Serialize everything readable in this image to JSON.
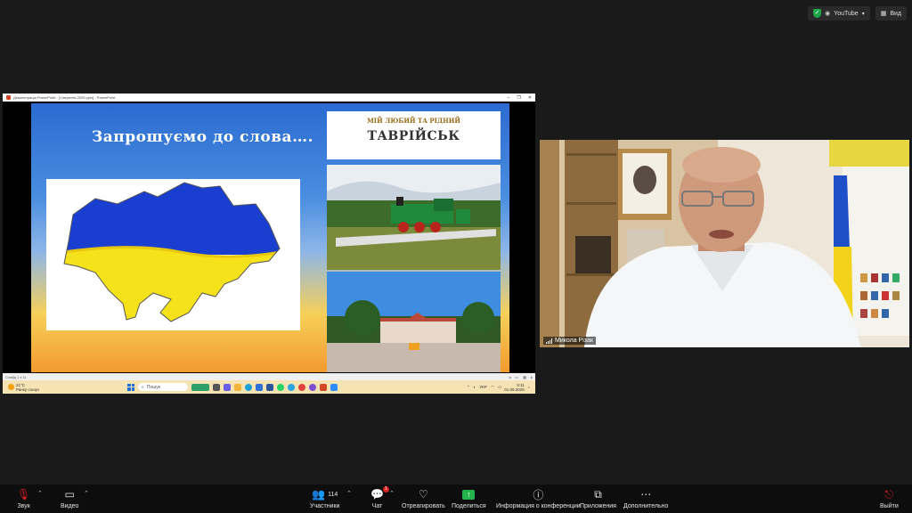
{
  "topbar": {
    "youtube_label": "YouTube",
    "view_label": "Вид"
  },
  "shared_window": {
    "title": "Демонстрація PowerPoint - [1 вересня 2025.pptx] - PowerPoint",
    "slide_title": "Запрошуємо до слова….",
    "right_header_line1": "МІЙ ЛЮБИЙ ТА РІДНИЙ",
    "right_header_line2": "ТАВРІЙСЬК",
    "status_left": "Слайд 1 з 11",
    "taskbar": {
      "temp": "21°C",
      "weather": "Ранку сонця",
      "search_placeholder": "Пошук",
      "lang": "УКР",
      "time": "9:11",
      "date": "01.09.2025"
    }
  },
  "participant": {
    "name": "Микола Різак"
  },
  "toolbar": {
    "audio_label": "Звук",
    "video_label": "Видео",
    "participants_label": "Участники",
    "participants_count": "114",
    "chat_label": "Чат",
    "chat_badge": "1",
    "react_label": "Отреагировать",
    "share_label": "Поделиться",
    "info_label": "Информация о конференции",
    "apps_label": "Приложения",
    "more_label": "Дополнительно",
    "leave_label": "Выйти"
  },
  "colors": {
    "share_green": "#22b34b",
    "ukraine_blue": "#1a3fd0",
    "ukraine_yellow": "#f6e21a",
    "badge_red": "#e02020"
  }
}
